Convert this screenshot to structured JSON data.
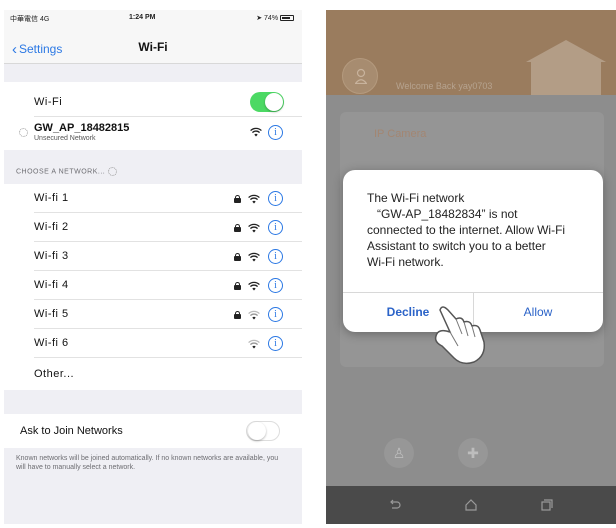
{
  "ios": {
    "status": {
      "carrier": "中華電信 4G",
      "time": "1:24 PM",
      "battery": "74%"
    },
    "nav": {
      "back_label": "Settings",
      "title": "Wi-Fi"
    },
    "wifi_row": {
      "label": "Wi-Fi",
      "enabled": true
    },
    "current_network": {
      "name": "GW_AP_18482815",
      "subtitle": "Unsecured Network"
    },
    "section_header": "CHOOSE A NETWORK...",
    "networks": [
      {
        "name": "Wi-fi 1",
        "secured": true
      },
      {
        "name": "Wi-fi 2",
        "secured": true
      },
      {
        "name": "Wi-fi 3",
        "secured": true
      },
      {
        "name": "Wi-fi 4",
        "secured": true
      },
      {
        "name": "Wi-fi 5",
        "secured": true
      },
      {
        "name": "Wi-fi 6",
        "secured": false
      }
    ],
    "other_label": "Other...",
    "ask_to_join": {
      "label": "Ask to Join Networks",
      "enabled": false
    },
    "footer_note": "Known networks will be joined automatically. If no known networks are available, you will have to manually select a network.",
    "colors": {
      "accent": "#2b78e4",
      "toggle_on": "#4cd964"
    }
  },
  "android": {
    "welcome": "Welcome Back yay0703",
    "camera_label": "IP Camera",
    "dialog": {
      "line1": "The Wi-Fi network",
      "line2": "“GW-AP_18482834” is not",
      "line3": "connected to the internet. Allow Wi-Fi",
      "line4": "Assistant to switch you to a better",
      "line5": "Wi-Fi network.",
      "decline_label": "Decline",
      "allow_label": "Allow"
    },
    "colors": {
      "header": "#9a7c5e",
      "button_text": "#2b63c8"
    }
  }
}
